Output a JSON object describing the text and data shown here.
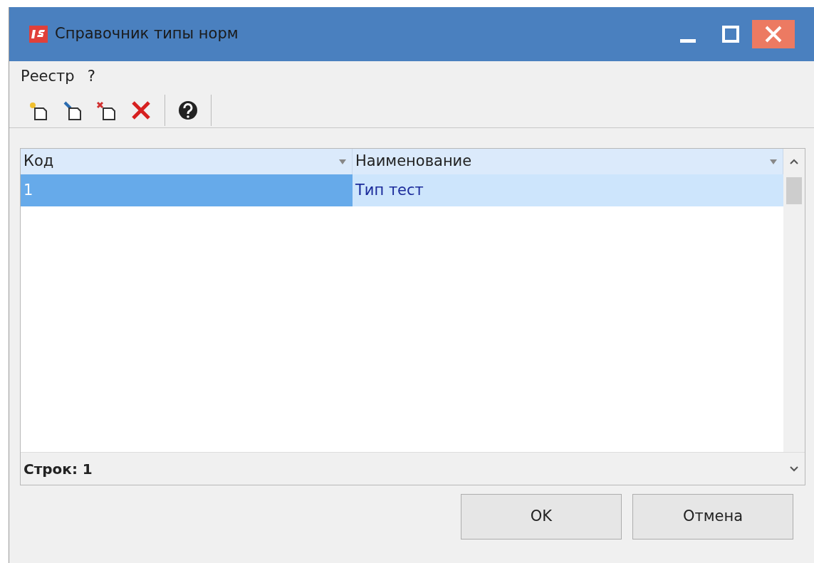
{
  "window": {
    "title": "Справочник типы норм"
  },
  "menu": [
    {
      "label": "Реестр"
    },
    {
      "label": "?"
    }
  ],
  "table": {
    "columns": [
      "Код",
      "Наименование"
    ],
    "rows": [
      {
        "cells": [
          "1",
          "Тип тест"
        ],
        "selected": true
      }
    ],
    "footer": "Строк: 1"
  },
  "buttons": [
    "OK",
    "Отмена"
  ]
}
